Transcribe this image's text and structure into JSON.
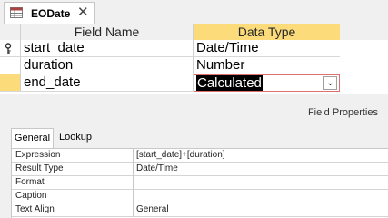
{
  "tab": {
    "title": "EODate",
    "icon": "table-design-icon",
    "close_label": "✕"
  },
  "grid": {
    "columns": {
      "field_name": "Field Name",
      "data_type": "Data Type"
    },
    "rows": [
      {
        "field_name": "start_date",
        "data_type": "Date/Time",
        "primary_key": true
      },
      {
        "field_name": "duration",
        "data_type": "Number"
      },
      {
        "field_name": "end_date",
        "data_type": "Calculated",
        "current": true
      }
    ],
    "dropdown_icon": "chevron-down-icon"
  },
  "field_properties": {
    "title": "Field Properties",
    "tabs": [
      "General",
      "Lookup"
    ],
    "active_tab": "General",
    "rows": [
      {
        "label": "Expression",
        "value": "[start_date]+[duration]"
      },
      {
        "label": "Result Type",
        "value": "Date/Time"
      },
      {
        "label": "Format",
        "value": ""
      },
      {
        "label": "Caption",
        "value": ""
      },
      {
        "label": "Text Align",
        "value": "General"
      }
    ]
  },
  "colors": {
    "accent": "#fcdc7a",
    "current_border": "#e07070",
    "selection": "#000000"
  }
}
